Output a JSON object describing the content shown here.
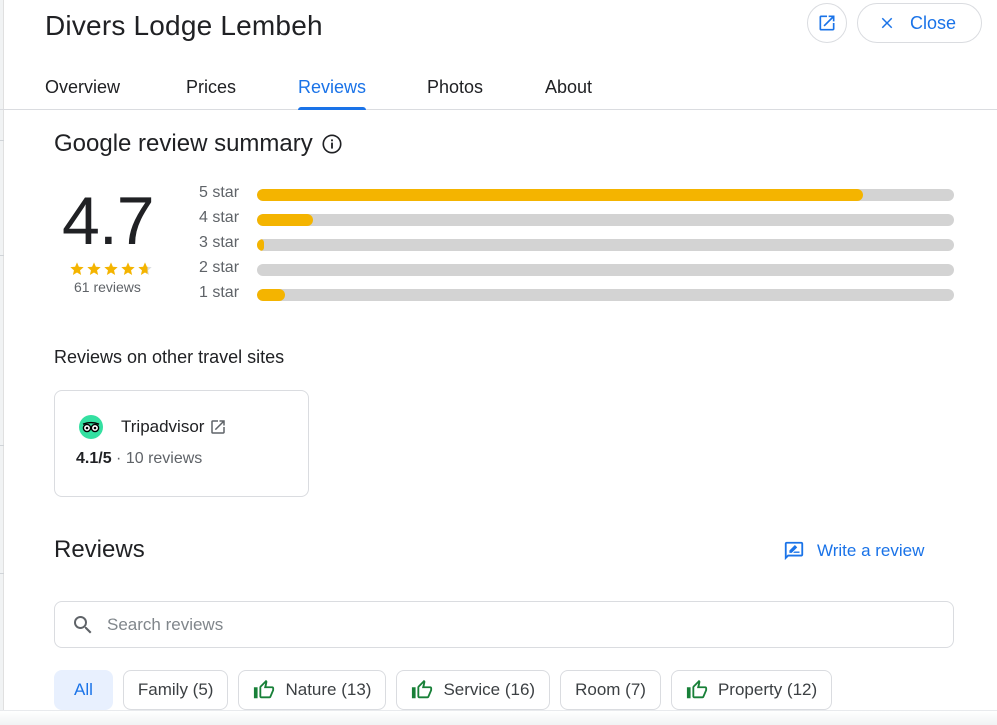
{
  "header": {
    "title": "Divers Lodge Lembeh",
    "close_label": "Close"
  },
  "tabs": [
    {
      "label": "Overview",
      "active": false
    },
    {
      "label": "Prices",
      "active": false
    },
    {
      "label": "Reviews",
      "active": true
    },
    {
      "label": "Photos",
      "active": false
    },
    {
      "label": "About",
      "active": false
    }
  ],
  "summary": {
    "title": "Google review summary",
    "rating": "4.7",
    "stars": 4.7,
    "review_count": "61 reviews",
    "bars": [
      {
        "label": "5 star",
        "fraction": 0.87
      },
      {
        "label": "4 star",
        "fraction": 0.08
      },
      {
        "label": "3 star",
        "fraction": 0.01
      },
      {
        "label": "2 star",
        "fraction": 0.0
      },
      {
        "label": "1 star",
        "fraction": 0.04
      }
    ]
  },
  "other_sites": {
    "title": "Reviews on other travel sites",
    "sites": [
      {
        "name": "Tripadvisor",
        "rating": "4.1/5",
        "reviews": "· 10 reviews"
      }
    ]
  },
  "reviews": {
    "title": "Reviews",
    "write_label": "Write a review",
    "search_placeholder": "Search reviews",
    "chips": [
      {
        "label": "All",
        "selected": true,
        "thumb": false
      },
      {
        "label": "Family (5)",
        "selected": false,
        "thumb": false
      },
      {
        "label": "Nature (13)",
        "selected": false,
        "thumb": true
      },
      {
        "label": "Service (16)",
        "selected": false,
        "thumb": true
      },
      {
        "label": "Room (7)",
        "selected": false,
        "thumb": false
      },
      {
        "label": "Property (12)",
        "selected": false,
        "thumb": true
      }
    ]
  },
  "colors": {
    "accent": "#1a73e8",
    "star": "#f4b400",
    "thumb": "#188038",
    "tripadvisor": "#34e0a1"
  }
}
